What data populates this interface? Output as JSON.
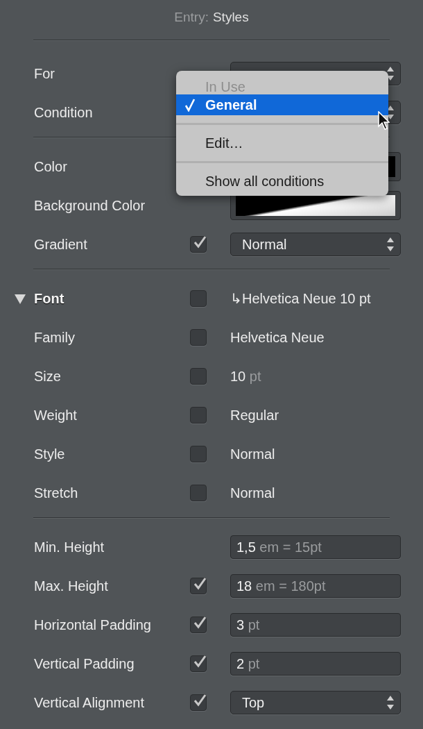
{
  "title": {
    "prefix": "Entry:",
    "name": "Styles"
  },
  "sections": [
    {
      "rows": [
        {
          "label": "For",
          "control": {
            "kind": "popup"
          }
        },
        {
          "label": "Condition",
          "control": {
            "kind": "popup"
          }
        }
      ]
    },
    {
      "rows": [
        {
          "label": "Color",
          "control": {
            "kind": "color_well"
          }
        },
        {
          "label": "Background Color",
          "control": {
            "kind": "gradient_well"
          }
        },
        {
          "label": "Gradient",
          "checked": true,
          "control": {
            "kind": "popup",
            "value": "Normal"
          }
        }
      ]
    },
    {
      "rows": [
        {
          "label": "Font",
          "kind": "group",
          "expanded": true,
          "checked": false,
          "control": {
            "kind": "text",
            "value": "↳Helvetica Neue 10 pt"
          }
        },
        {
          "label": "Family",
          "checked": false,
          "control": {
            "kind": "text",
            "value": "Helvetica Neue"
          }
        },
        {
          "label": "Size",
          "checked": false,
          "control": {
            "kind": "text",
            "value": "10",
            "unit": "pt"
          }
        },
        {
          "label": "Weight",
          "checked": false,
          "control": {
            "kind": "text",
            "value": "Regular"
          }
        },
        {
          "label": "Style",
          "checked": false,
          "control": {
            "kind": "text",
            "value": "Normal"
          }
        },
        {
          "label": "Stretch",
          "checked": false,
          "control": {
            "kind": "text",
            "value": "Normal"
          }
        }
      ]
    },
    {
      "rows": [
        {
          "label": "Min. Height",
          "control": {
            "kind": "field",
            "value": "1,5",
            "unit": "em = 15pt"
          }
        },
        {
          "label": "Max. Height",
          "checked": true,
          "control": {
            "kind": "field",
            "value": "18",
            "unit": "em = 180pt"
          }
        },
        {
          "label": "Horizontal Padding",
          "checked": true,
          "control": {
            "kind": "field",
            "value": "3",
            "unit": "pt"
          }
        },
        {
          "label": "Vertical Padding",
          "checked": true,
          "control": {
            "kind": "field",
            "value": "2",
            "unit": "pt"
          }
        },
        {
          "label": "Vertical Alignment",
          "checked": true,
          "control": {
            "kind": "popup",
            "value": "Top"
          }
        }
      ]
    }
  ],
  "menu": {
    "items": [
      {
        "kind": "header",
        "label": "In Use",
        "disabled": true
      },
      {
        "kind": "item",
        "label": "General",
        "selected": true
      },
      {
        "kind": "separator"
      },
      {
        "kind": "item",
        "label": "Edit…",
        "selected": false
      },
      {
        "kind": "separator"
      },
      {
        "kind": "item",
        "label": "Show all conditions",
        "selected": false
      }
    ]
  }
}
